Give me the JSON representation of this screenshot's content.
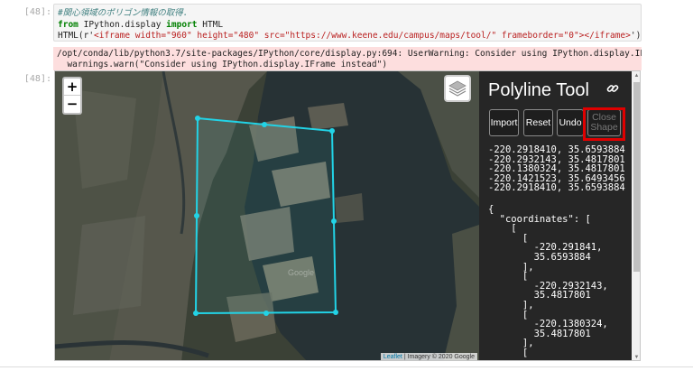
{
  "cells": {
    "code_prompt": "[48]:",
    "code_lines": {
      "comment": "#関心領域のポリゴン情報の取得.",
      "import_from": "from",
      "import_module": "IPython.display",
      "import_kw": "import",
      "import_name": "HTML",
      "html_call": "HTML(r'",
      "html_string": "<iframe width=\"960\" height=\"480\" src=\"https://www.keene.edu/campus/maps/tool/\" frameborder=\"0\"></iframe>",
      "html_close": "')"
    },
    "warning_lines": [
      "/opt/conda/lib/python3.7/site-packages/IPython/core/display.py:694: UserWarning: Consider using IPython.display.IFrame instead",
      "  warnings.warn(\"Consider using IPython.display.IFrame instead\")"
    ],
    "output_prompt": "[48]:"
  },
  "map": {
    "zoom_in": "+",
    "zoom_out": "−",
    "watermark": "Google",
    "attribution_link": "Leaflet",
    "attribution_text": "| Imagery © 2020 Google",
    "polygon_color": "#22d3e6"
  },
  "tool": {
    "title": "Polyline Tool",
    "buttons": {
      "import": "Import",
      "reset": "Reset",
      "undo": "Undo",
      "close_shape_1": "Close",
      "close_shape_2": "Shape"
    },
    "coordinates_list": "-220.2918410, 35.6593884\n-220.2932143, 35.4817801\n-220.1380324, 35.4817801\n-220.1421523, 35.6493456\n-220.2918410, 35.6593884",
    "geojson": "{\n  \"coordinates\": [\n    [\n      [\n        -220.291841,\n        35.6593884\n      ],\n      [\n        -220.2932143,\n        35.4817801\n      ],\n      [\n        -220.1380324,\n        35.4817801\n      ],\n      ["
  }
}
